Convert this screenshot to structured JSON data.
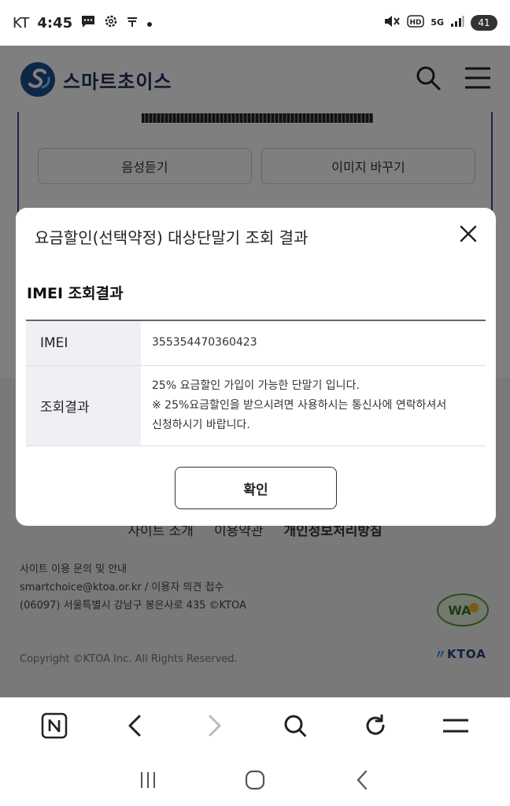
{
  "status_bar": {
    "carrier": "KT",
    "time": "4:45",
    "battery": "41",
    "network": "5G"
  },
  "header": {
    "site_name": "스마트초이스",
    "brand_color": "#1a4f8f"
  },
  "page": {
    "listen_button": "음성듣기",
    "change_image_button": "이미지 바꾸기"
  },
  "footer": {
    "links": [
      "사이트 소개",
      "이용약관",
      "개인정보처리방침"
    ],
    "info_heading": "사이트 이용 문의 및 안내",
    "contact": "smartchoice@ktoa.or.kr / 이용자 의견 접수",
    "address": "(06097) 서울특별시 강남구 봉은사로 435 ©KTOA",
    "copyright": "Copyright ©KTOA Inc. All Rights Reserved.",
    "ktoa_logo": "KTOA",
    "wa_badge": "WA"
  },
  "modal": {
    "title": "요금할인(선택약정) 대상단말기 조회 결과",
    "section_title": "IMEI 조회결과",
    "rows": [
      {
        "label": "IMEI",
        "value": "355354470360423"
      },
      {
        "label": "조회결과",
        "lines": [
          "25% 요금할인 가입이 가능한 단말기 입니다.",
          "※ 25%요금할인을 받으시려면 사용하시는 통신사에 연락하셔서",
          "신청하시기 바랍니다."
        ]
      }
    ],
    "confirm_button": "확인"
  },
  "icons": {
    "status": [
      "chat-icon",
      "settings-icon",
      "usb-icon",
      "mute-icon",
      "hd-icon",
      "signal-icon",
      "battery-icon"
    ],
    "browser": [
      "naver-home-icon",
      "back-icon",
      "forward-icon",
      "search-icon",
      "refresh-icon",
      "menu-icon"
    ],
    "system": [
      "recents-icon",
      "home-icon",
      "back-icon"
    ]
  }
}
